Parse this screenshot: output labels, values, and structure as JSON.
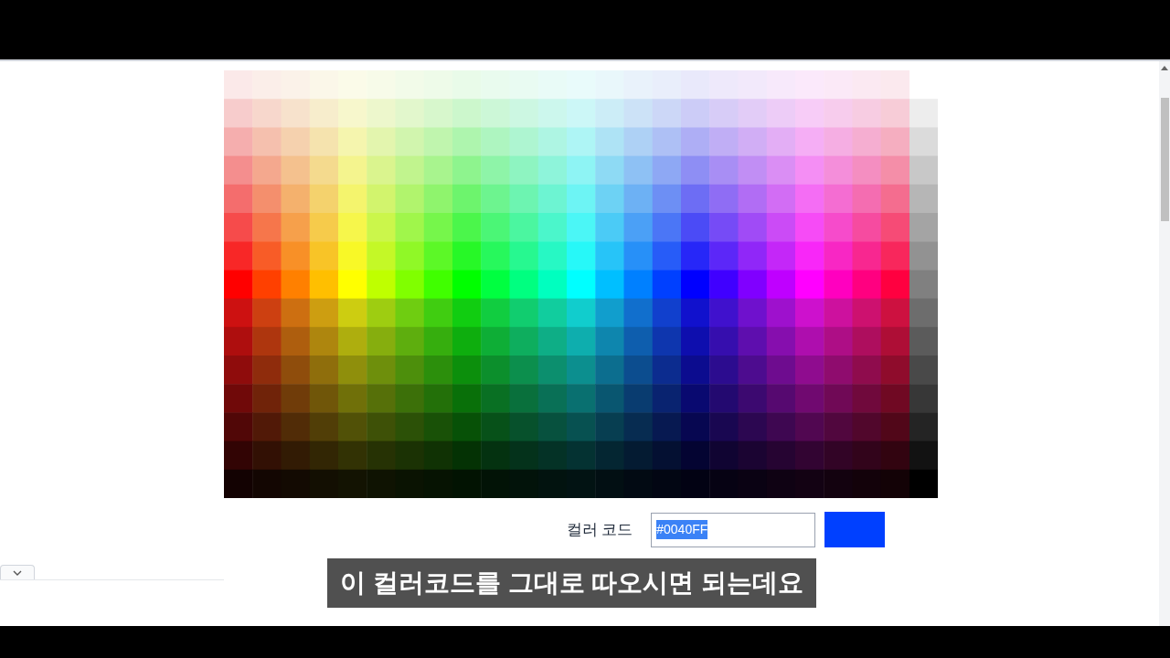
{
  "color_code": {
    "label": "컬러 코드",
    "value": "#0040FF",
    "value_selected": true
  },
  "caption": "이 컬러코드를 그대로 따오시면 되는데요"
}
